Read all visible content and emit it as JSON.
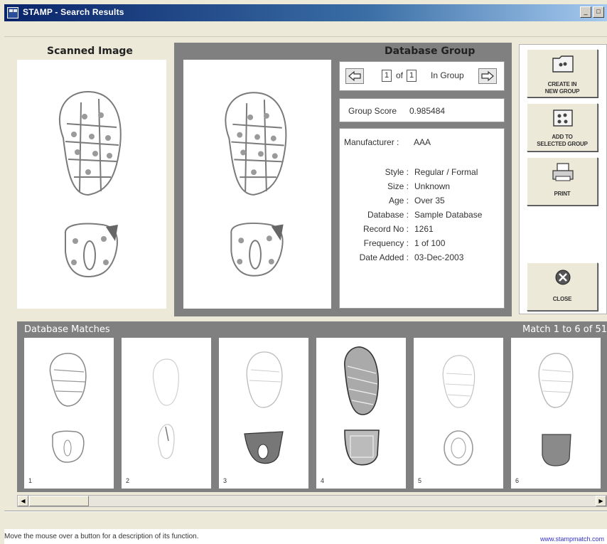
{
  "window": {
    "title": "STAMP - Search Results",
    "minimize": "_",
    "maximize": "□"
  },
  "scanned": {
    "label": "Scanned Image"
  },
  "database_group": {
    "label": "Database Group",
    "current": "1",
    "of_label": "of",
    "total": "1",
    "in_group_label": "In Group",
    "score_label": "Group Score",
    "score_value": "0.985484"
  },
  "record": {
    "manufacturer_key": "Manufacturer :",
    "manufacturer_val": "AAA",
    "style_key": "Style :",
    "style_val": "Regular / Formal",
    "size_key": "Size :",
    "size_val": "Unknown",
    "age_key": "Age :",
    "age_val": "Over 35",
    "database_key": "Database :",
    "database_val": "Sample Database",
    "recordno_key": "Record No :",
    "recordno_val": "1261",
    "frequency_key": "Frequency :",
    "frequency_val": "1 of 100",
    "dateadded_key": "Date Added :",
    "dateadded_val": "03-Dec-2003"
  },
  "actions": {
    "create_line1": "CREATE IN",
    "create_line2": "NEW GROUP",
    "add_line1": "ADD TO",
    "add_line2": "SELECTED GROUP",
    "print": "PRINT",
    "close": "CLOSE"
  },
  "matches": {
    "title": "Database Matches",
    "count": "Match 1 to 6 of 51",
    "items": [
      {
        "num": "1"
      },
      {
        "num": "2"
      },
      {
        "num": "3"
      },
      {
        "num": "4"
      },
      {
        "num": "5"
      },
      {
        "num": "6"
      }
    ]
  },
  "status": {
    "hint": "Move the mouse over a button for a description of its function.",
    "link": "www.stampmatch.com"
  }
}
